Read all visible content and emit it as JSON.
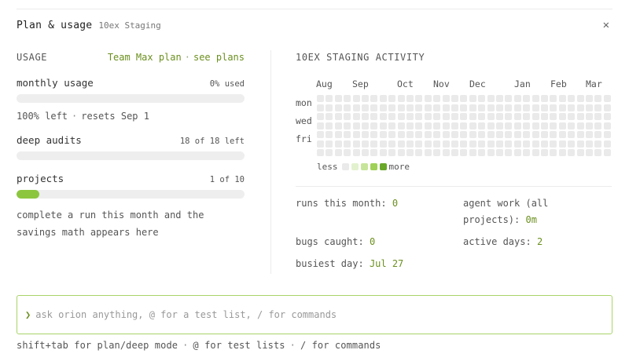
{
  "header": {
    "title": "Plan & usage",
    "subtitle": "10ex Staging",
    "close_icon": "✕"
  },
  "usage": {
    "heading": "USAGE",
    "plan_name": "Team Max plan",
    "separator": "·",
    "see_plans": "see plans",
    "monthly": {
      "label": "monthly usage",
      "value": "0% used",
      "fraction": 0.0,
      "left": "100% left",
      "resets": "resets Sep 1"
    },
    "audits": {
      "label": "deep audits",
      "value": "18 of 18 left",
      "fraction": 0.0
    },
    "projects": {
      "label": "projects",
      "value": "1 of 10",
      "fraction": 0.1
    },
    "blurb_line1": "complete a run this month and the",
    "blurb_line2": "savings math appears here"
  },
  "activity": {
    "heading": "10EX STAGING ACTIVITY",
    "months": [
      "Aug",
      "Sep",
      "Oct",
      "Nov",
      "Dec",
      "Jan",
      "Feb",
      "Mar"
    ],
    "day_labels": [
      "mon",
      "wed",
      "fri"
    ],
    "legend_less": "less",
    "legend_more": "more",
    "legend_colors": [
      "#eaeaea",
      "#e3f1cf",
      "#c7e59a",
      "#9fd157",
      "#6aa82a"
    ],
    "empty_cell_color": "#eaeaea",
    "weeks": 33,
    "days_per_week": 7
  },
  "stats": {
    "runs_label": "runs this month:",
    "runs_value": "0",
    "agent_label_1": "agent work (all",
    "agent_label_2": "projects):",
    "agent_value": "0m",
    "bugs_label": "bugs caught:",
    "bugs_value": "0",
    "active_label": "active days:",
    "active_value": "2",
    "busiest_label": "busiest day:",
    "busiest_value": "Jul 27"
  },
  "input": {
    "caret": "❯",
    "placeholder": "ask orion anything, @ for a test list, / for commands",
    "value": ""
  },
  "hint": {
    "part1": "shift+tab for plan/deep mode",
    "part2": "@ for test lists",
    "part3": "/ for commands",
    "separator": "·"
  },
  "colors": {
    "accent": "#6b8f1f",
    "bar_fill": "#8cc63f",
    "input_border": "#a9d46a"
  }
}
